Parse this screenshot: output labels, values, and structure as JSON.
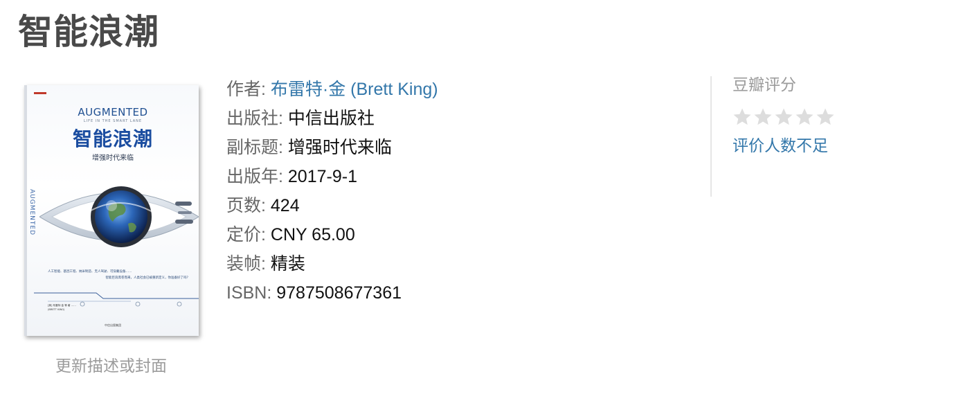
{
  "page": {
    "title": "智能浪潮"
  },
  "cover": {
    "en_title": "AUGMENTED",
    "tagline": "LIFE IN THE SMART LANE",
    "cn_title": "智能浪潮",
    "cn_subtitle": "增强时代来临",
    "side_text": "AUGMENTED",
    "blurb_line1": "人工智能、基因工程、纳米制造、无人驾驶、可穿戴设备……",
    "blurb_line2": "智能巨浪席卷而来，人类社会已被重新定义，你准备好了吗？",
    "credits": "[美] 布雷特·金 等 著 ……",
    "credits_en": "(BRETT KING)",
    "publisher": "中信出版集团"
  },
  "update_link": "更新描述或封面",
  "info": [
    {
      "label": "作者:",
      "value": "布雷特·金 (Brett King)",
      "is_link": true
    },
    {
      "label": "出版社:",
      "value": "中信出版社",
      "is_link": false
    },
    {
      "label": "副标题:",
      "value": "增强时代来临",
      "is_link": false
    },
    {
      "label": "出版年:",
      "value": "2017-9-1",
      "is_link": false
    },
    {
      "label": "页数:",
      "value": "424",
      "is_link": false
    },
    {
      "label": "定价:",
      "value": "CNY 65.00",
      "is_link": false
    },
    {
      "label": "装帧:",
      "value": "精装",
      "is_link": false
    },
    {
      "label": "ISBN:",
      "value": "9787508677361",
      "is_link": false
    }
  ],
  "rating": {
    "title": "豆瓣评分",
    "stars_filled": 0,
    "stars_total": 5,
    "note": "评价人数不足"
  },
  "colors": {
    "link": "#3377aa",
    "label": "#666666",
    "muted": "#9b9b9b",
    "star_empty": "#dddddd"
  }
}
